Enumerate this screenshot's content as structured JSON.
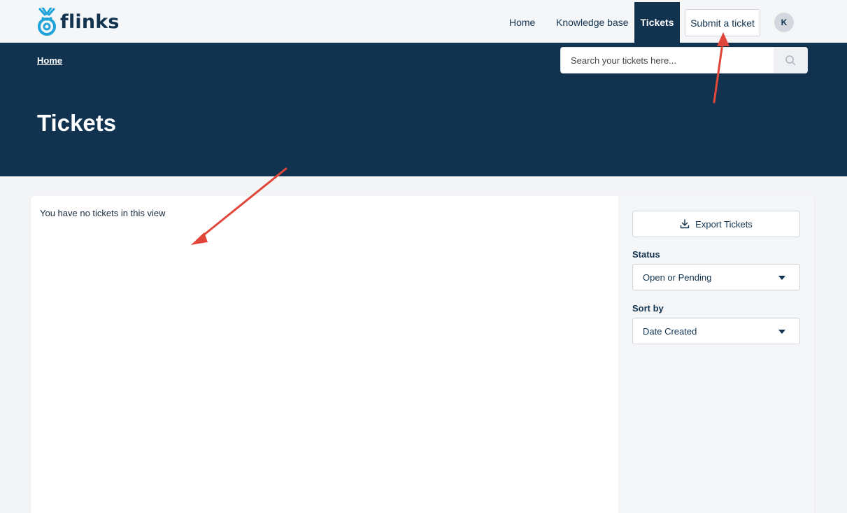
{
  "brand": {
    "name": "flinks",
    "color": "#12334f",
    "accent": "#1fa3d8"
  },
  "nav": {
    "home": "Home",
    "knowledge_base": "Knowledge base",
    "tickets": "Tickets",
    "submit": "Submit a ticket",
    "avatar_initial": "K"
  },
  "hero": {
    "breadcrumb": "Home",
    "title": "Tickets",
    "search_placeholder": "Search your tickets here...",
    "search_icon": "search-icon"
  },
  "content": {
    "empty_message": "You have no tickets in this view"
  },
  "sidebar": {
    "export_label": "Export Tickets",
    "export_icon": "download-icon",
    "status_label": "Status",
    "status_value": "Open or Pending",
    "sort_label": "Sort by",
    "sort_value": "Date Created"
  },
  "colors": {
    "header_bg": "#f5f6f8",
    "hero_bg": "#12334f",
    "annotation_arrow": "#e0473a"
  }
}
